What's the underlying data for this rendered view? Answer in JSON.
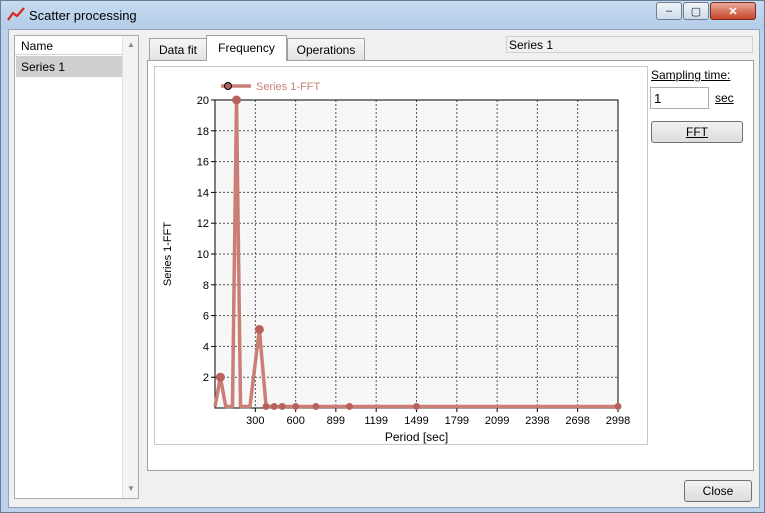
{
  "window": {
    "title": "Scatter processing",
    "controls": {
      "minimize": "–",
      "maximize": "▢",
      "close": "✕"
    }
  },
  "sidebar": {
    "header": "Name",
    "items": [
      "Series 1"
    ]
  },
  "tabs": [
    {
      "label": "Data fit",
      "active": false
    },
    {
      "label": "Frequency",
      "active": true
    },
    {
      "label": "Operations",
      "active": false
    }
  ],
  "selected_series": "Series 1",
  "side_panel": {
    "sampling_label": "Sampling time:",
    "sampling_value": "1",
    "sampling_unit": "sec",
    "fft_button": "FFT"
  },
  "close_button": "Close",
  "colors": {
    "series": "#c97f76",
    "marker": "#b8615a",
    "accent": "#d9271b"
  },
  "chart_data": {
    "type": "line",
    "title": "",
    "xlabel": "Period [sec]",
    "ylabel": "Series 1-FFT",
    "legend": {
      "entries": [
        "Series 1-FFT"
      ],
      "placement": "top-left"
    },
    "grid": true,
    "xlim": [
      0,
      2998
    ],
    "ylim": [
      0,
      20
    ],
    "x_ticks": [
      "300",
      "600",
      "899",
      "1199",
      "1499",
      "1799",
      "2099",
      "2398",
      "2698",
      "2998"
    ],
    "y_ticks": [
      "2",
      "4",
      "6",
      "8",
      "10",
      "12",
      "14",
      "16",
      "18",
      "20"
    ],
    "series": [
      {
        "name": "Series 1-FFT",
        "points": [
          [
            0,
            0.1
          ],
          [
            40,
            2.0
          ],
          [
            80,
            0.1
          ],
          [
            130,
            0.1
          ],
          [
            160,
            20.0
          ],
          [
            190,
            0.1
          ],
          [
            260,
            0.1
          ],
          [
            330,
            5.1
          ],
          [
            380,
            0.1
          ],
          [
            440,
            0.1
          ],
          [
            500,
            0.1
          ],
          [
            600,
            0.1
          ],
          [
            750,
            0.1
          ],
          [
            1000,
            0.1
          ],
          [
            1499,
            0.1
          ],
          [
            2998,
            0.1
          ]
        ],
        "markers": [
          40,
          160,
          330,
          380,
          440,
          500,
          600,
          750,
          1000,
          1499,
          2998
        ]
      }
    ]
  }
}
